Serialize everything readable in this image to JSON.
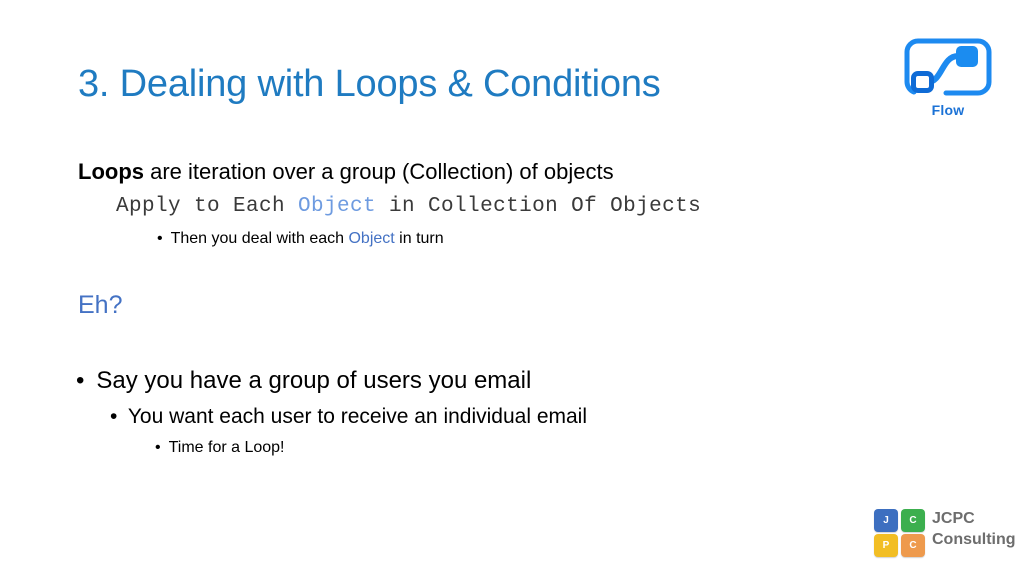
{
  "slide": {
    "background": "#FFFFFF",
    "title": "3. Dealing with Loops & Conditions",
    "title_color": "#1F7BC1"
  },
  "body": {
    "loops_line": {
      "bold_lead": "Loops",
      "rest": " are iteration over a group (Collection) of objects"
    },
    "mono_line": {
      "part1": "Apply to Each ",
      "highlight": "Object",
      "part2": " in Collection Of Objects",
      "highlight_color": "#6E9BE0"
    },
    "then_line": {
      "bullet": "•",
      "part1": "Then you deal with each ",
      "highlight": "Object",
      "part2": " in turn",
      "highlight_color": "#4472C4"
    },
    "eh_line": {
      "text": "Eh?",
      "color": "#4472C4"
    },
    "bullets": [
      {
        "bullet": "•",
        "text": "Say you have a group of users you email"
      },
      {
        "bullet": "•",
        "text": "You want each user to receive an individual email"
      },
      {
        "bullet": "•",
        "text": "Time for a Loop!"
      }
    ]
  },
  "flow_logo": {
    "label": "Flow",
    "label_color": "#1B72D6",
    "outline_color": "#1D8AF0",
    "node_fill_color": "#1B8CF0",
    "node_outline_color": "#0F6BD6"
  },
  "jcpc_logo": {
    "tiles": [
      {
        "letter": "J",
        "color": "#3D6FC0"
      },
      {
        "letter": "C",
        "color": "#3CAF4E"
      },
      {
        "letter": "P",
        "color": "#F2BE24"
      },
      {
        "letter": "C",
        "color": "#EE9A4D"
      }
    ],
    "word_top": "JCPC",
    "word_bottom": "Consulting",
    "word_color": "#6D6D6D"
  }
}
